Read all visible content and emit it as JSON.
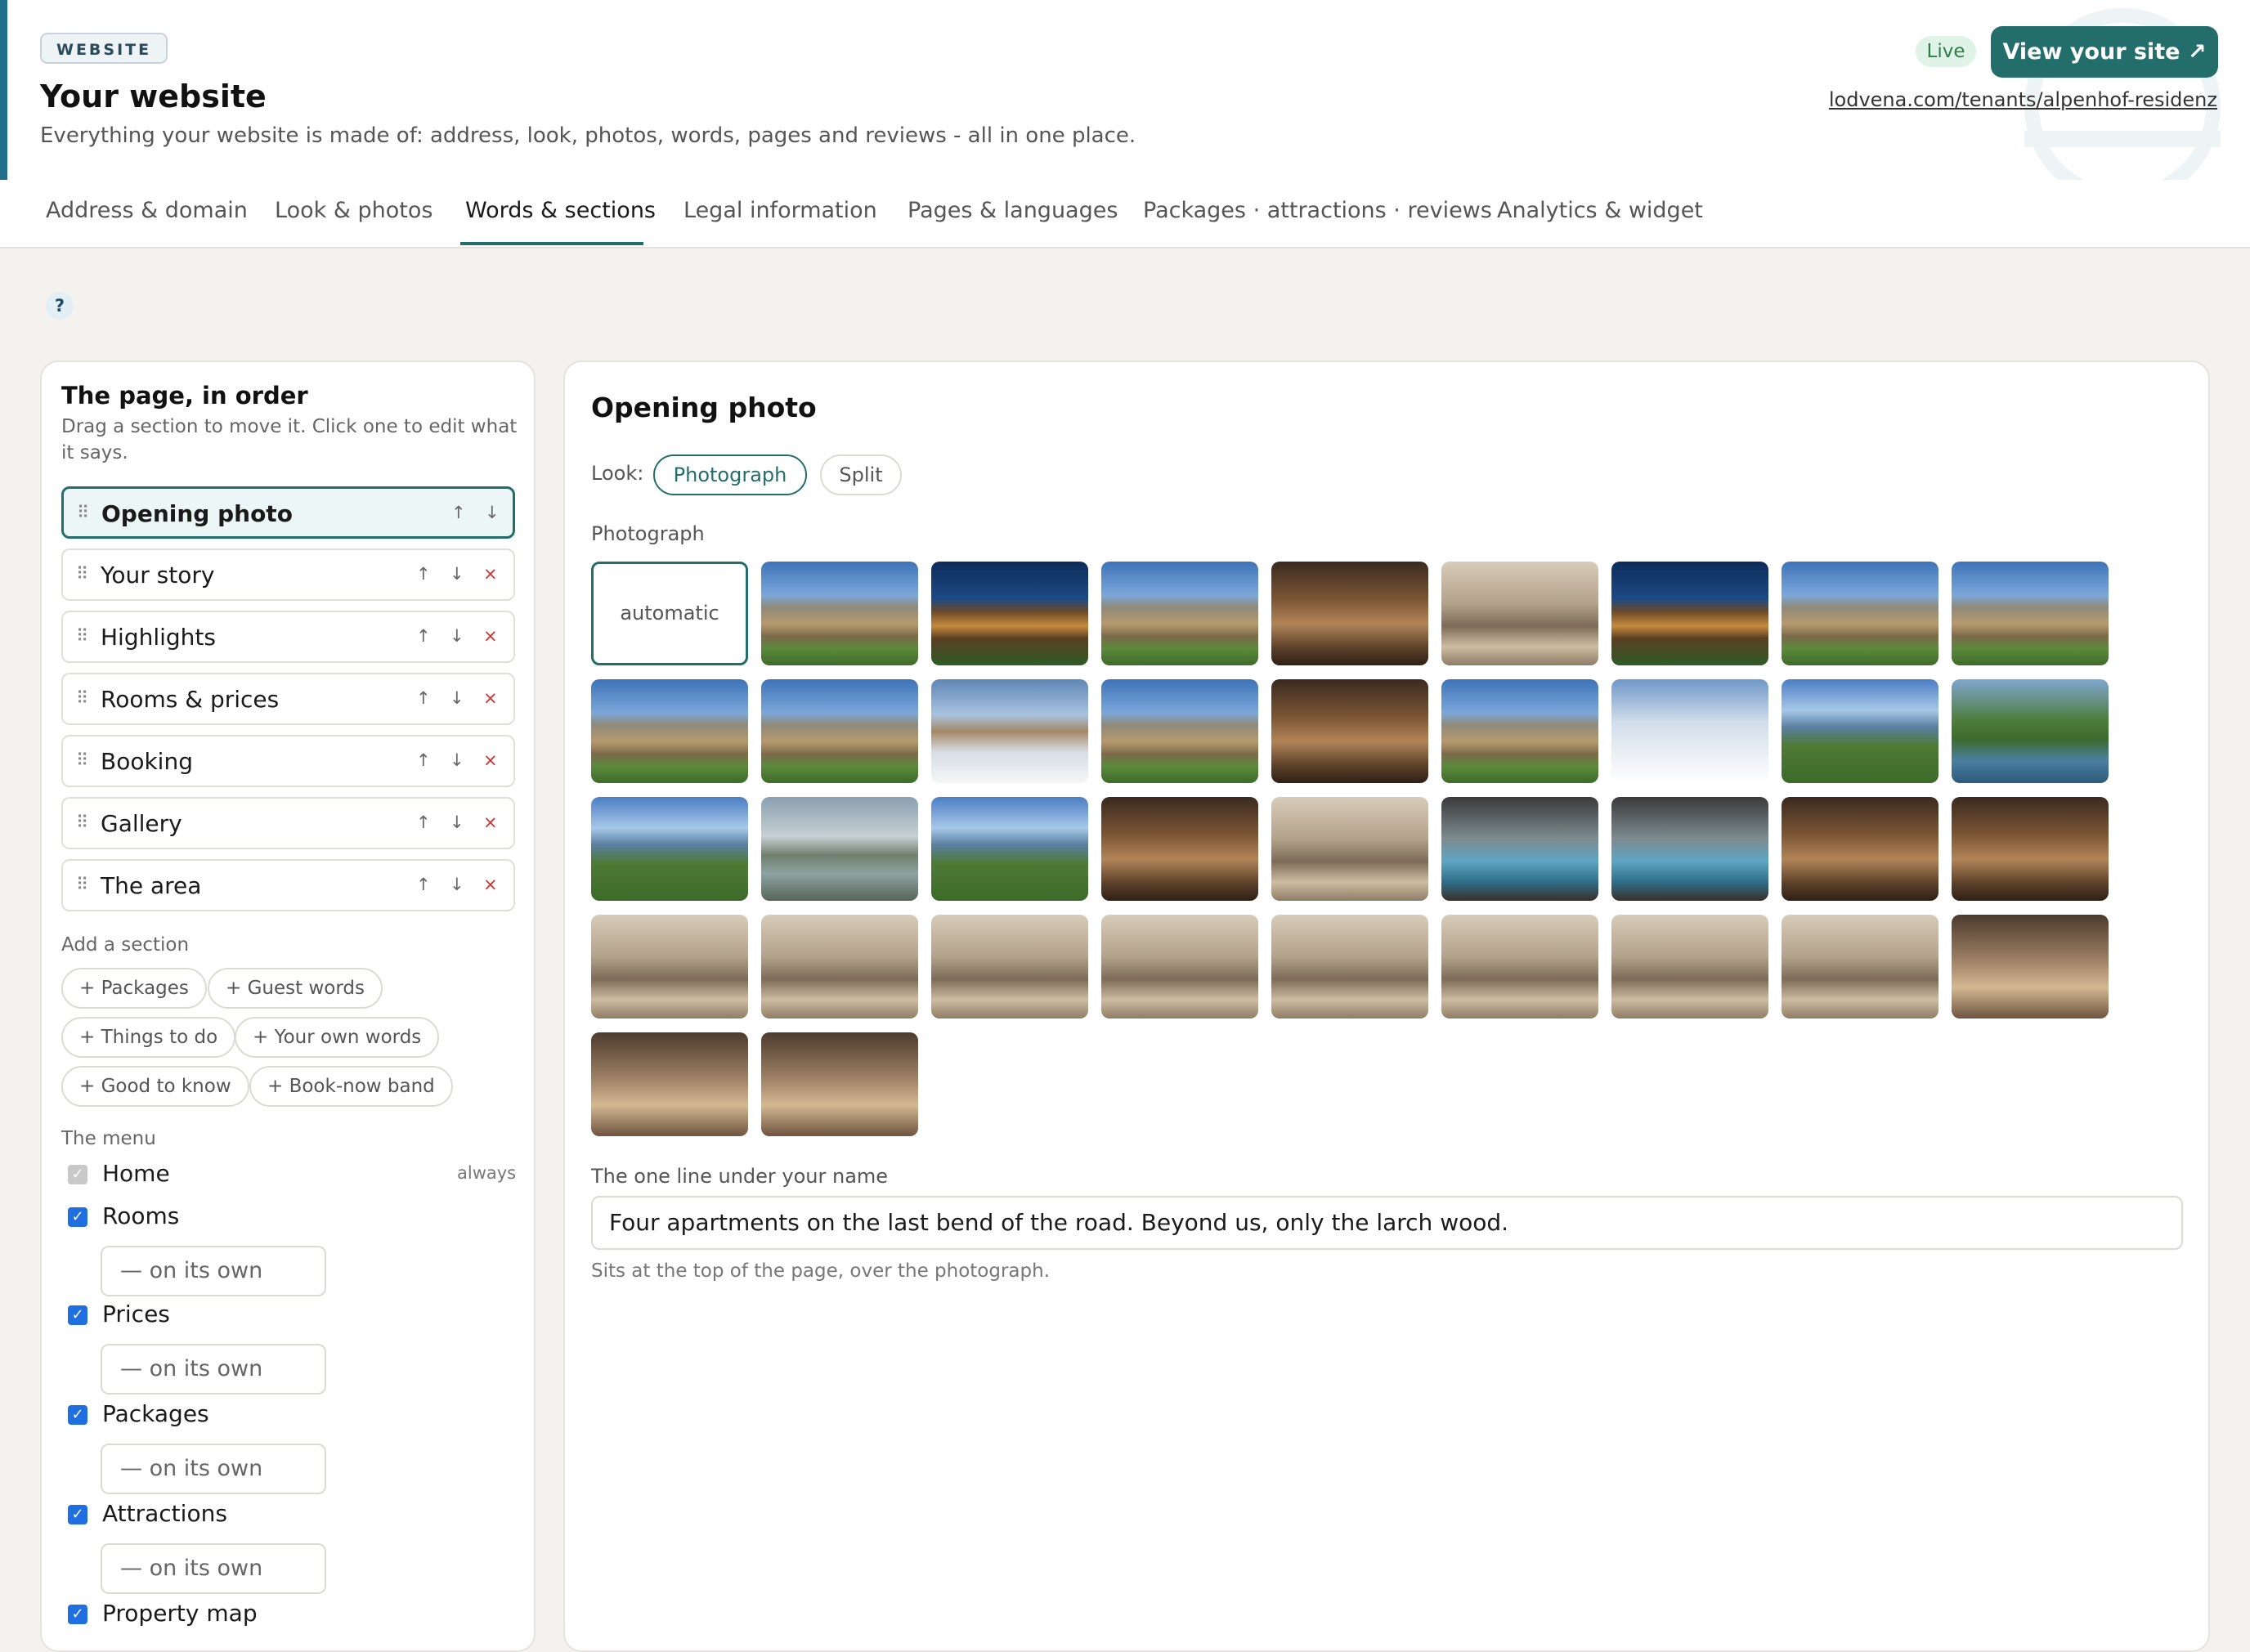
{
  "header": {
    "badge": "WEBSITE",
    "title": "Your website",
    "subtitle": "Everything your website is made of: address, look, photos, words, pages and reviews - all in one place.",
    "status": "Live",
    "view_button": "View your site ↗",
    "url": "lodvena.com/tenants/alpenhof-residenz"
  },
  "tabs": [
    {
      "label": "Address & domain"
    },
    {
      "label": "Look & photos"
    },
    {
      "label": "Words & sections",
      "active": true
    },
    {
      "label": "Legal information"
    },
    {
      "label": "Pages & languages"
    },
    {
      "label": "Packages · attractions · reviews"
    },
    {
      "label": "Analytics & widget"
    }
  ],
  "help_label": "?",
  "sections_panel": {
    "title": "The page, in order",
    "description": "Drag a section to move it. Click one to edit what it says.",
    "sections": [
      {
        "label": "Opening photo",
        "active": true
      },
      {
        "label": "Your story"
      },
      {
        "label": "Highlights"
      },
      {
        "label": "Rooms & prices"
      },
      {
        "label": "Booking"
      },
      {
        "label": "Gallery"
      },
      {
        "label": "The area"
      }
    ],
    "controls": {
      "up": "↑",
      "down": "↓",
      "remove": "×"
    },
    "add_title": "Add a section",
    "add_chips": [
      "+ Packages",
      "+ Guest words",
      "+ Things to do",
      "+ Your own words",
      "+ Good to know",
      "+ Book-now band"
    ],
    "menu_title": "The menu",
    "menu_items": [
      {
        "label": "Home",
        "checked": true,
        "disabled": true,
        "note": "always"
      },
      {
        "label": "Rooms",
        "checked": true,
        "placement": "— on its own"
      },
      {
        "label": "Prices",
        "checked": true,
        "placement": "— on its own"
      },
      {
        "label": "Packages",
        "checked": true,
        "placement": "— on its own"
      },
      {
        "label": "Attractions",
        "checked": true,
        "placement": "— on its own"
      },
      {
        "label": "Property map",
        "checked": true
      }
    ]
  },
  "editor": {
    "title": "Opening photo",
    "look_label": "Look:",
    "look_options": [
      "Photograph",
      "Split"
    ],
    "look_selected": "Photograph",
    "photo_label": "Photograph",
    "photo_auto": "automatic",
    "photos": [
      "exterior",
      "night",
      "exterior",
      "interior",
      "room",
      "night",
      "exterior",
      "exterior",
      "exterior",
      "exterior",
      "snow",
      "exterior",
      "interior",
      "exterior",
      "winter",
      "mountain",
      "river",
      "mountain",
      "lake",
      "mountain",
      "interior",
      "room",
      "spa",
      "spa",
      "interior",
      "interior",
      "room",
      "room",
      "room",
      "room",
      "room",
      "room",
      "room",
      "room",
      "bath",
      "bath",
      "bath"
    ],
    "tagline_label": "The one line under your name",
    "tagline_value": "Four apartments on the last bend of the road. Beyond us, only the larch wood.",
    "tagline_hint": "Sits at the top of the page, over the photograph."
  },
  "colors": {
    "accent": "#236e6b",
    "checkbox": "#1f6fe0",
    "live": "#2f7d4b"
  }
}
